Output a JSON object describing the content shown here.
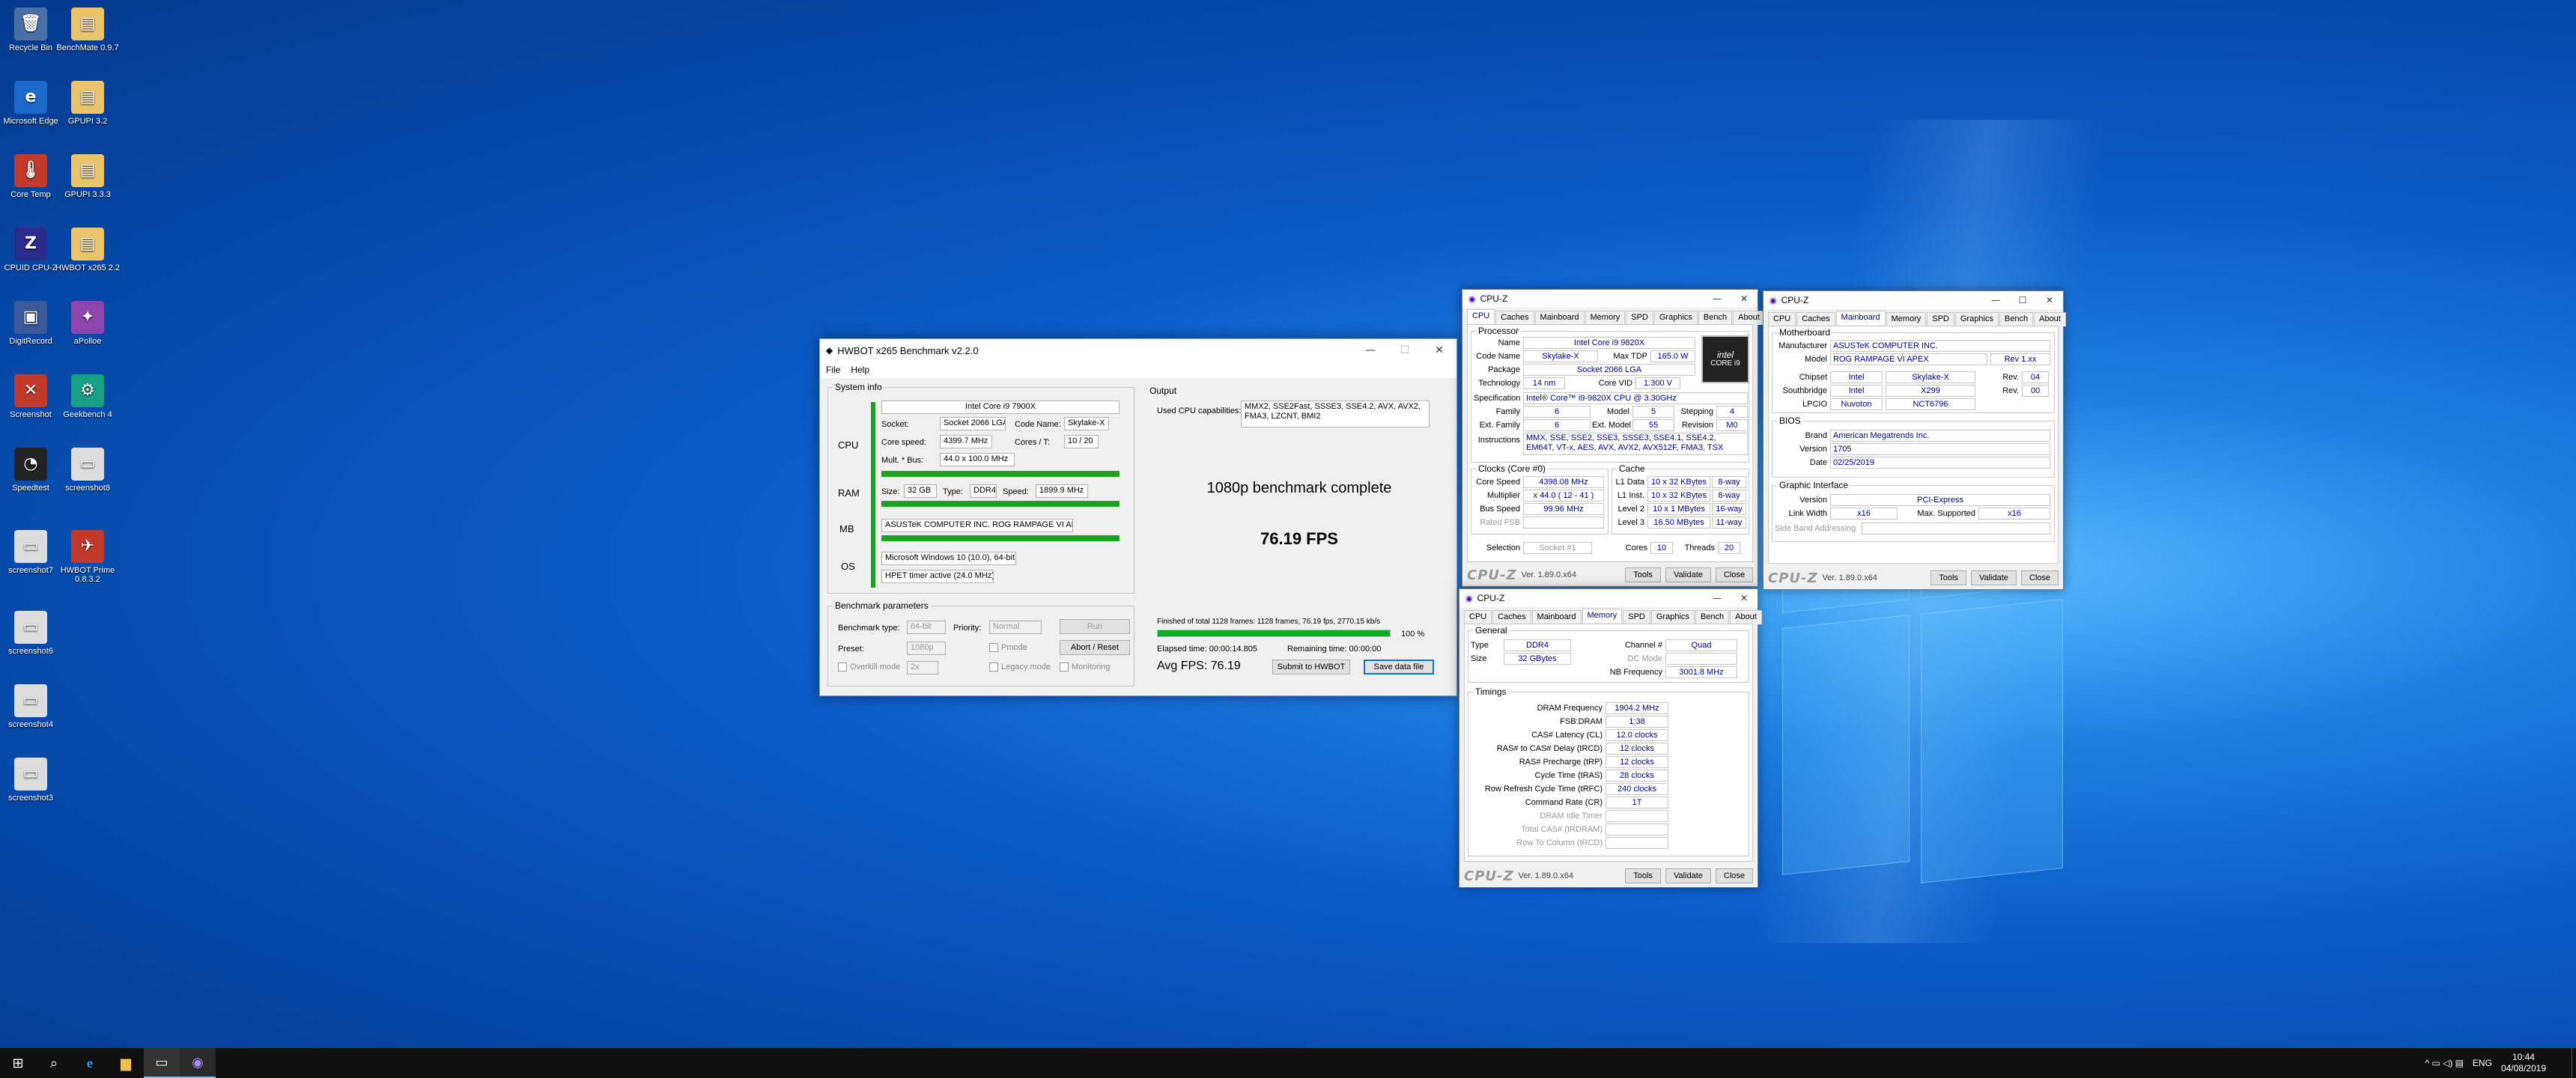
{
  "desktop": {
    "icons": [
      {
        "label": "Recycle Bin",
        "glyph": "🗑",
        "bg": "#4a6fa5"
      },
      {
        "label": "BenchMate 0.9.7",
        "glyph": "▤",
        "bg": "#e9c46a"
      },
      {
        "label": "Microsoft Edge",
        "glyph": "e",
        "bg": "#1b6ac9"
      },
      {
        "label": "GPUPI 3.2",
        "glyph": "▤",
        "bg": "#e9c46a"
      },
      {
        "label": "Core Temp",
        "glyph": "🌡",
        "bg": "#c0392b"
      },
      {
        "label": "GPUPI 3.3.3",
        "glyph": "▤",
        "bg": "#e9c46a"
      },
      {
        "label": "CPUID CPU-Z",
        "glyph": "Z",
        "bg": "#2b2b8c"
      },
      {
        "label": "HWBOT x265 2.2",
        "glyph": "▤",
        "bg": "#e9c46a"
      },
      {
        "label": "DigitRecord",
        "glyph": "▣",
        "bg": "#3b5998"
      },
      {
        "label": "aPolloe",
        "glyph": "✦",
        "bg": "#8e44ad"
      },
      {
        "label": "Screenshot",
        "glyph": "✕",
        "bg": "#c0392b"
      },
      {
        "label": "Geekbench 4",
        "glyph": "⚙",
        "bg": "#16a085"
      },
      {
        "label": "Speedtest",
        "glyph": "◔",
        "bg": "#222222"
      },
      {
        "label": "screenshot8",
        "glyph": "▭",
        "bg": "#dddddd"
      },
      {
        "label": "screenshot7",
        "glyph": "▭",
        "bg": "#dddddd"
      },
      {
        "label": "HWBOT Prime 0.8.3.2",
        "glyph": "✈",
        "bg": "#c0392b"
      },
      {
        "label": "screenshot6",
        "glyph": "▭",
        "bg": "#dddddd"
      },
      {
        "label": "screenshot4",
        "glyph": "▭",
        "bg": "#dddddd"
      },
      {
        "label": "screenshot3",
        "glyph": "▭",
        "bg": "#dddddd"
      }
    ]
  },
  "hwbot": {
    "title": "HWBOT x265 Benchmark v2.2.0",
    "menu": [
      "File",
      "Help"
    ],
    "system_info_label": "System info",
    "cpu_name": "Intel Core i9 7900X",
    "row_labels": {
      "cpu": "CPU",
      "ram": "RAM",
      "mb": "MB",
      "os": "OS"
    },
    "socket_label": "Socket:",
    "socket": "Socket 2066 LGA",
    "codename_label": "Code Name:",
    "codename": "Skylake-X",
    "speed_label": "Core speed:",
    "speed": "4399.7 MHz",
    "cores_label": "Cores / T:",
    "cores": "10 / 20",
    "mult_label": "Mult. * Bus:",
    "mult": "44.0 x 100.0 MHz",
    "ram_size_label": "Size:",
    "ram_size": "32 GB",
    "ram_type_label": "Type:",
    "ram_type": "DDR4",
    "ram_speed_label": "Speed:",
    "ram_speed": "1899.9 MHz",
    "mb": "ASUSTeK COMPUTER INC. ROG RAMPAGE VI APEX",
    "os": "Microsoft Windows 10 (10.0), 64-bit",
    "timer": "HPET timer active (24.0 MHz)",
    "bench_params_label": "Benchmark parameters",
    "bench_type_label": "Benchmark type:",
    "bench_type": "64-bit",
    "priority_label": "Priority:",
    "priority": "Normal",
    "run": "Run",
    "preset_label": "Preset:",
    "preset": "1080p",
    "pmode": "Pmode",
    "abort": "Abort / Reset",
    "overkill": "Overkill mode",
    "overkill_val": "2x",
    "legacy": "Legacy mode",
    "monitoring": "Monitoring",
    "output_label": "Output",
    "caps_label": "Used CPU capabilities:",
    "caps": "MMX2, SSE2Fast, SSSE3, SSE4.2, AVX, AVX2, FMA3, LZCNT, BMI2",
    "complete": "1080p benchmark complete",
    "fps": "76.19 FPS",
    "status": "Finished of total 1128 frames: 1128 frames, 76.19 fps,  2770.15 kb/s",
    "progress_pct": "100 %",
    "progress": 1.0,
    "elapsed": "Elapsed time: 00:00:14.805",
    "remaining": "Remaining time: 00:00:00",
    "avg": "Avg FPS: 76.19",
    "submit": "Submit to HWBOT",
    "save": "Save data file"
  },
  "cpuz_cpu": {
    "title": "CPU-Z",
    "tabs": [
      "CPU",
      "Caches",
      "Mainboard",
      "Memory",
      "SPD",
      "Graphics",
      "Bench",
      "About"
    ],
    "processor_label": "Processor",
    "name_label": "Name",
    "name": "Intel Core i9 9820X",
    "codename_label": "Code Name",
    "codename": "Skylake-X",
    "tdp_label": "Max TDP",
    "tdp": "165.0 W",
    "package_label": "Package",
    "package": "Socket 2066 LGA",
    "tech_label": "Technology",
    "tech": "14 nm",
    "vid_label": "Core VID",
    "vid": "1.300 V",
    "spec_label": "Specification",
    "spec": "Intel® Core™ i9-9820X CPU @ 3.30GHz",
    "family_label": "Family",
    "family": "6",
    "model_label": "Model",
    "model": "5",
    "stepping_label": "Stepping",
    "stepping": "4",
    "extfam_label": "Ext. Family",
    "extfam": "6",
    "extmodel_label": "Ext. Model",
    "extmodel": "55",
    "revision_label": "Revision",
    "revision": "M0",
    "instr_label": "Instructions",
    "instr": "MMX, SSE, SSE2, SSE3, SSSE3, SSE4.1, SSE4.2, EM64T, VT-x, AES, AVX, AVX2, AVX512F, FMA3, TSX",
    "clocks_label": "Clocks (Core #0)",
    "corespeed_label": "Core Speed",
    "corespeed": "4398.08 MHz",
    "mult_label": "Multiplier",
    "mult": "x 44.0 ( 12 - 41 )",
    "bus_label": "Bus Speed",
    "bus": "99.96 MHz",
    "fsb_label": "Rated FSB",
    "fsb": "",
    "cache_label": "Cache",
    "l1d_label": "L1 Data",
    "l1d": "10 x 32 KBytes",
    "l1d_w": "8-way",
    "l1i_label": "L1 Inst.",
    "l1i": "10 x 32 KBytes",
    "l1i_w": "8-way",
    "l2_label": "Level 2",
    "l2": "10 x 1 MBytes",
    "l2_w": "16-way",
    "l3_label": "Level 3",
    "l3": "16.50 MBytes",
    "l3_w": "11-way",
    "sel_label": "Selection",
    "sel": "Socket #1",
    "cores_label": "Cores",
    "cores": "10",
    "threads_label": "Threads",
    "threads": "20",
    "logo": "CPU-Z",
    "ver": "Ver. 1.89.0.x64",
    "tools": "Tools",
    "validate": "Validate",
    "close": "Close",
    "intel_badge": "CORE i9"
  },
  "cpuz_mb": {
    "title": "CPU-Z",
    "tabs": [
      "CPU",
      "Caches",
      "Mainboard",
      "Memory",
      "SPD",
      "Graphics",
      "Bench",
      "About"
    ],
    "mb_label": "Motherboard",
    "manu_label": "Manufacturer",
    "manu": "ASUSTeK COMPUTER INC.",
    "model_label": "Model",
    "model": "ROG RAMPAGE VI APEX",
    "model_rev": "Rev 1.xx",
    "chipset_label": "Chipset",
    "chipset": "Intel",
    "chipset2": "Skylake-X",
    "rev_label": "Rev.",
    "chipset_rev": "04",
    "south_label": "Southbridge",
    "south": "Intel",
    "south2": "X299",
    "south_rev": "00",
    "lpcio_label": "LPCIO",
    "lpcio": "Nuvoton",
    "lpcio2": "NCT6796",
    "bios_label": "BIOS",
    "brand_label": "Brand",
    "brand": "American Megatrends Inc.",
    "version_label": "Version",
    "version": "1705",
    "date_label": "Date",
    "date": "02/25/2019",
    "gi_label": "Graphic Interface",
    "giver_label": "Version",
    "giver": "PCI-Express",
    "lw_label": "Link Width",
    "lw": "x16",
    "ms_label": "Max. Supported",
    "ms": "x16",
    "sba_label": "Side Band Addressing",
    "logo": "CPU-Z",
    "ver": "Ver. 1.89.0.x64",
    "tools": "Tools",
    "validate": "Validate",
    "close": "Close"
  },
  "cpuz_mem": {
    "title": "CPU-Z",
    "tabs": [
      "CPU",
      "Caches",
      "Mainboard",
      "Memory",
      "SPD",
      "Graphics",
      "Bench",
      "About"
    ],
    "general_label": "General",
    "type_label": "Type",
    "type": "DDR4",
    "channel_label": "Channel #",
    "channel": "Quad",
    "size_label": "Size",
    "size": "32 GBytes",
    "dc_label": "DC Mode",
    "nb_label": "NB Frequency",
    "nb": "3001.8 MHz",
    "timings_label": "Timings",
    "rows": [
      {
        "l": "DRAM Frequency",
        "v": "1904.2 MHz"
      },
      {
        "l": "FSB:DRAM",
        "v": "1:38"
      },
      {
        "l": "CAS# Latency (CL)",
        "v": "12.0 clocks"
      },
      {
        "l": "RAS# to CAS# Delay (tRCD)",
        "v": "12 clocks"
      },
      {
        "l": "RAS# Precharge (tRP)",
        "v": "12 clocks"
      },
      {
        "l": "Cycle Time (tRAS)",
        "v": "28 clocks"
      },
      {
        "l": "Row Refresh Cycle Time (tRFC)",
        "v": "240 clocks"
      },
      {
        "l": "Command Rate (CR)",
        "v": "1T"
      },
      {
        "l": "DRAM Idle Timer",
        "v": ""
      },
      {
        "l": "Total CAS# (tRDRAM)",
        "v": ""
      },
      {
        "l": "Row To Column (tRCD)",
        "v": ""
      }
    ],
    "logo": "CPU-Z",
    "ver": "Ver. 1.89.0.x64",
    "tools": "Tools",
    "validate": "Validate",
    "close": "Close"
  },
  "taskbar": {
    "time": "10:44",
    "date": "04/08/2019",
    "lang": "ENG",
    "tray": "^  ▭  ◁)  ▤"
  }
}
